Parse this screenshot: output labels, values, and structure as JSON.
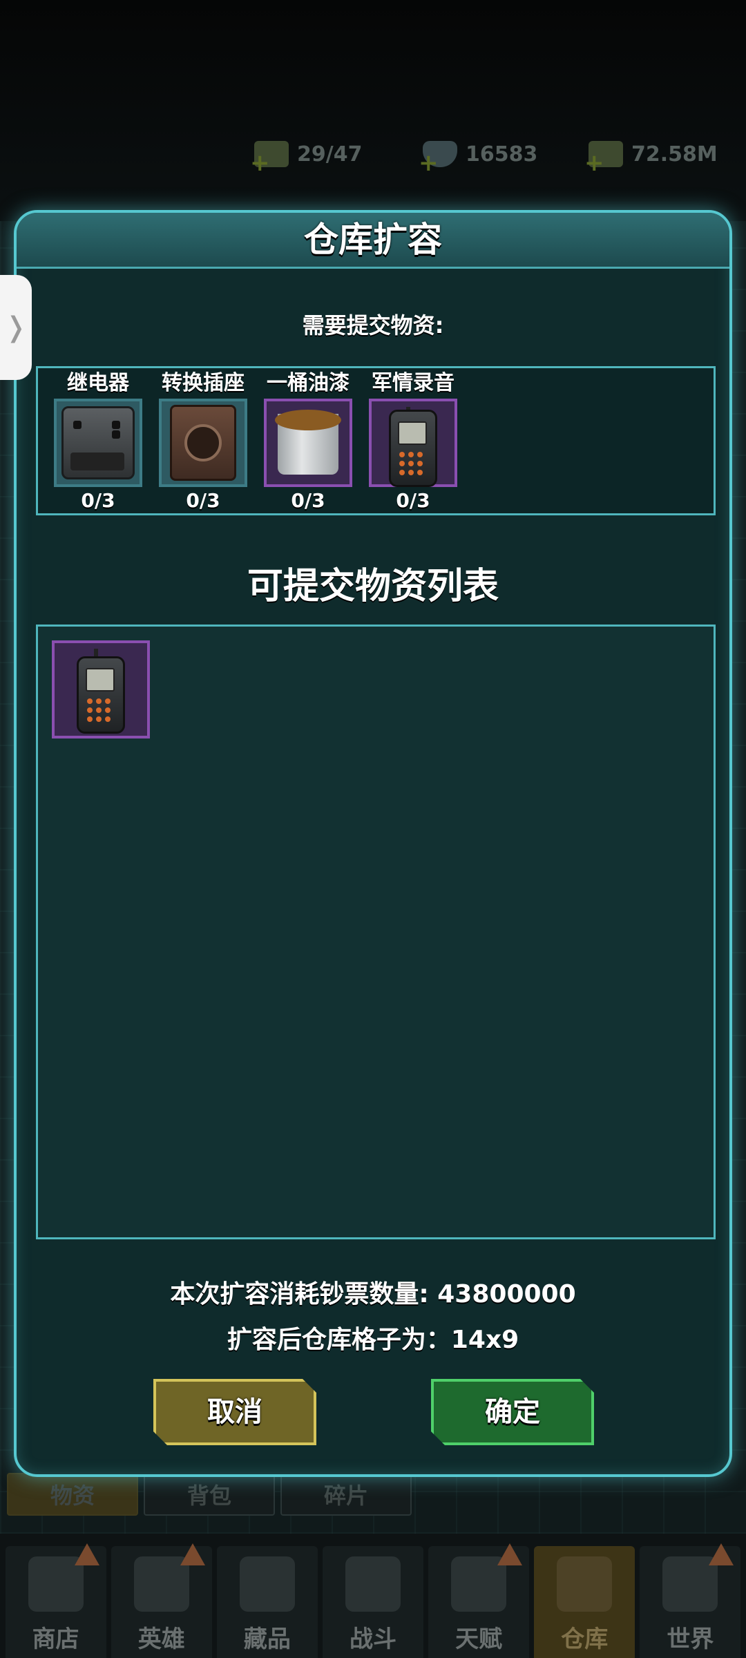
{
  "resources": [
    {
      "icon": "cash-stack-icon",
      "value": "29/47"
    },
    {
      "icon": "diamond-icon",
      "value": "16583"
    },
    {
      "icon": "money-icon",
      "value": "72.58M"
    }
  ],
  "background_tabs": [
    "物资",
    "背包",
    "碎片"
  ],
  "bottom_nav": [
    {
      "label": "商店",
      "icon": "shop-cart-icon",
      "alert": true
    },
    {
      "label": "英雄",
      "icon": "hero-icon",
      "alert": true
    },
    {
      "label": "藏品",
      "icon": "collection-flame-icon",
      "alert": false
    },
    {
      "label": "战斗",
      "icon": "rifle-icon",
      "alert": false
    },
    {
      "label": "天赋",
      "icon": "dna-icon",
      "alert": true
    },
    {
      "label": "仓库",
      "icon": "warehouse-box-icon",
      "alert": false,
      "active": true
    },
    {
      "label": "世界",
      "icon": "world-beast-icon",
      "alert": true
    }
  ],
  "modal": {
    "title": "仓库扩容",
    "required_label": "需要提交物资:",
    "required_items": [
      {
        "name": "继电器",
        "count": "0/3",
        "rarity": "blue",
        "icon": "relay-icon"
      },
      {
        "name": "转换插座",
        "count": "0/3",
        "rarity": "blue",
        "icon": "socket-icon"
      },
      {
        "name": "一桶油漆",
        "count": "0/3",
        "rarity": "purple",
        "icon": "paint-bucket-icon"
      },
      {
        "name": "军情录音",
        "count": "0/3",
        "rarity": "purple",
        "icon": "radio-recorder-icon"
      }
    ],
    "list_title": "可提交物资列表",
    "available_items": [
      {
        "icon": "radio-recorder-icon",
        "rarity": "purple"
      }
    ],
    "cost_text": "本次扩容消耗钞票数量: 43800000",
    "result_text": "扩容后仓库格子为：14x9",
    "cancel_label": "取消",
    "confirm_label": "确定"
  },
  "colors": {
    "modal_border": "#56c8d0",
    "cancel_button": "#6f6526",
    "confirm_button": "#1e6a2e",
    "rarity_blue": "#3d7c86",
    "rarity_purple": "#8a4fb0"
  }
}
